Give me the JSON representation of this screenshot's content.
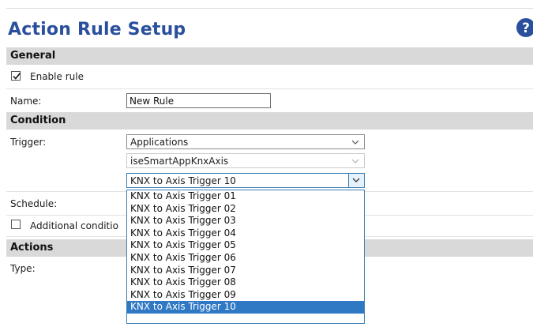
{
  "page": {
    "title": "Action Rule Setup"
  },
  "general": {
    "heading": "General",
    "enable_rule_label": "Enable rule",
    "enable_rule_checked": true,
    "name_label": "Name:",
    "name_value": "New Rule"
  },
  "condition": {
    "heading": "Condition",
    "trigger_label": "Trigger:",
    "trigger_value": "Applications",
    "app_value": "iseSmartAppKnxAxis",
    "event_value": "KNX to Axis Trigger 10",
    "schedule_label": "Schedule:",
    "additional_label": "Additional conditio",
    "additional_checked": false
  },
  "actions": {
    "heading": "Actions",
    "type_label": "Type:"
  },
  "dropdown": {
    "options": [
      "KNX to Axis Trigger 01",
      "KNX to Axis Trigger 02",
      "KNX to Axis Trigger 03",
      "KNX to Axis Trigger 04",
      "KNX to Axis Trigger 05",
      "KNX to Axis Trigger 06",
      "KNX to Axis Trigger 07",
      "KNX to Axis Trigger 08",
      "KNX to Axis Trigger 09",
      "KNX to Axis Trigger 10"
    ],
    "selected_index": 9
  },
  "icons": {
    "help": "help-icon",
    "checkmark": "checkmark-icon",
    "chevron": "chevron-down-icon"
  },
  "colors": {
    "title": "#2a4f9c",
    "section_bg": "#d9d9d9",
    "selection": "#2f78c4"
  }
}
